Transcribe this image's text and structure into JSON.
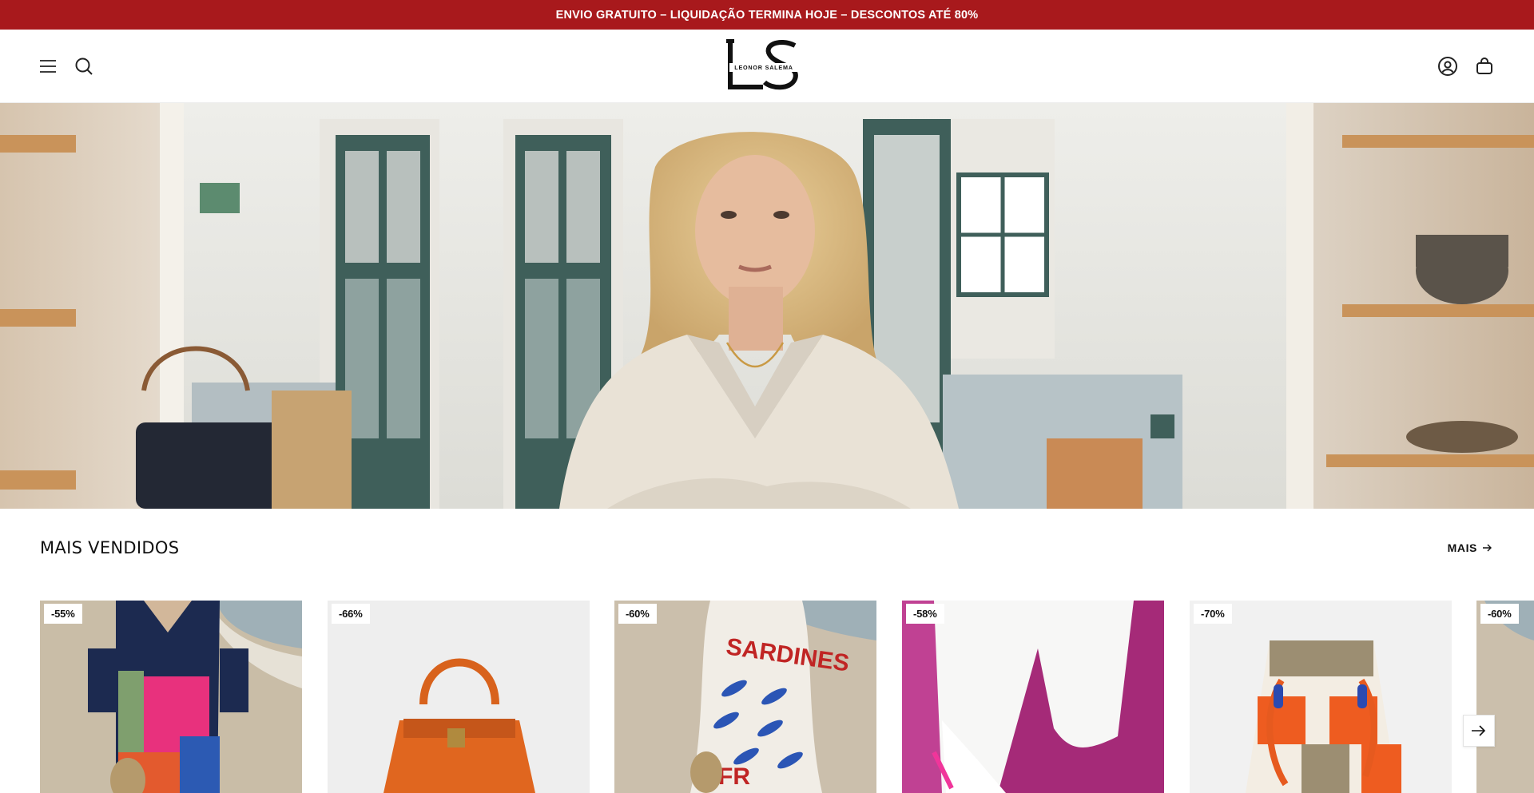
{
  "announcement": {
    "text": "ENVIO GRATUITO – LIQUIDAÇÃO TERMINA HOJE – DESCONTOS ATÉ 80%"
  },
  "header": {
    "brand_monogram": "LS",
    "brand_name": "LEONOR SALEMA",
    "icons": [
      "menu-icon",
      "search-icon",
      "account-icon",
      "cart-icon"
    ]
  },
  "hero": {
    "image": "woman-in-beige-blazer-in-shop"
  },
  "bestsellers": {
    "title": "MAIS VENDIDOS",
    "more_label": "MAIS",
    "products": [
      {
        "badge": "-55%",
        "image": "colorblock-tunic-dress-on-beach"
      },
      {
        "badge": "-66%",
        "image": "orange-leather-handbag"
      },
      {
        "badge": "-60%",
        "image": "sardines-print-dress-on-beach"
      },
      {
        "badge": "-58%",
        "image": "white-wide-trousers-pink-heels"
      },
      {
        "badge": "-70%",
        "image": "orange-striped-bucket-bag"
      },
      {
        "badge": "-60%",
        "image": "partial-product-card"
      }
    ]
  },
  "colors": {
    "announcement_bg": "#a8191c",
    "text": "#111111",
    "background": "#ffffff"
  }
}
